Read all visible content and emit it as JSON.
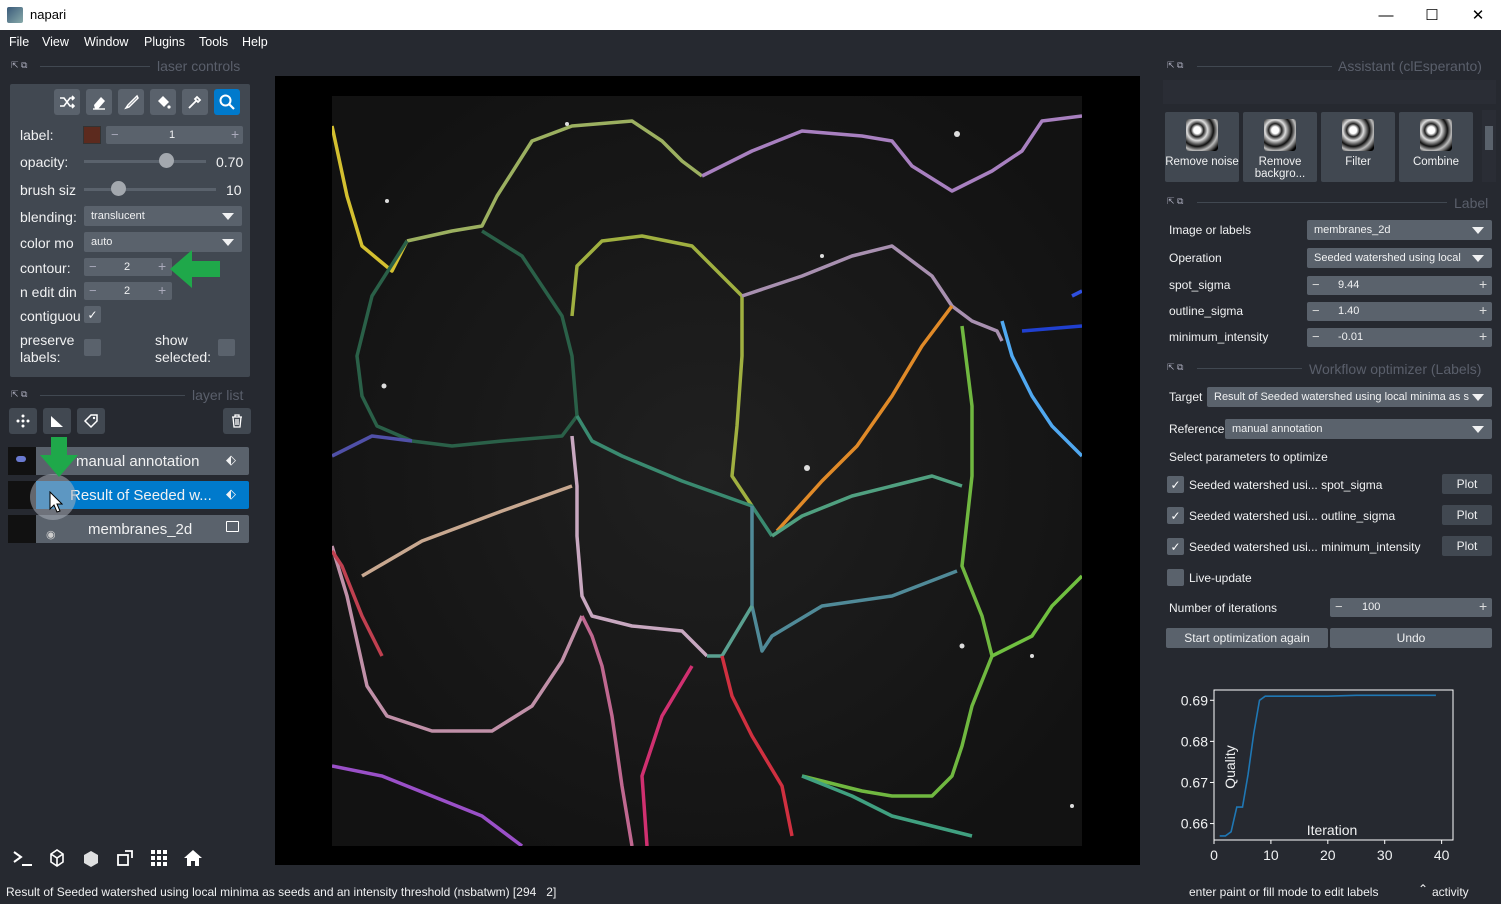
{
  "window": {
    "title": "napari",
    "minimize": "—",
    "maximize": "☐",
    "close": "✕"
  },
  "menu": [
    "File",
    "View",
    "Window",
    "Plugins",
    "Tools",
    "Help"
  ],
  "layer_controls": {
    "header": "laser controls",
    "label_label": "label:",
    "label_value": "1",
    "label_color": "#5c2a1e",
    "opacity_label": "opacity:",
    "opacity_value": "0.70",
    "opacity_fraction": 0.7,
    "brush_label": "brush siz",
    "brush_value": "10",
    "brush_fraction": 0.27,
    "blending_label": "blending:",
    "blending_value": "translucent",
    "colormode_label": "color mo",
    "colormode_value": "auto",
    "contour_label": "contour:",
    "contour_value": "2",
    "ndim_label": "n edit din",
    "ndim_value": "2",
    "contiguous_label": "contiguou",
    "preserve_label": "preserve labels:",
    "show_selected_label": "show selected:"
  },
  "layer_list": {
    "header": "layer list",
    "layers": [
      {
        "name": "manual annotation",
        "selected": false
      },
      {
        "name": "Result of Seeded w...",
        "selected": true
      },
      {
        "name": "membranes_2d",
        "selected": false
      }
    ]
  },
  "assistant": {
    "header": "Assistant (clEsperanto)",
    "tiles": [
      "Remove noise",
      "Remove backgro...",
      "Filter",
      "Combine"
    ]
  },
  "label_widget": {
    "header": "Label",
    "rows": [
      {
        "label": "Image or labels",
        "value": "membranes_2d",
        "type": "combo"
      },
      {
        "label": "Operation",
        "value": "Seeded watershed using local",
        "type": "combo"
      },
      {
        "label": "spot_sigma",
        "value": "9.44",
        "type": "spin"
      },
      {
        "label": "outline_sigma",
        "value": "1.40",
        "type": "spin"
      },
      {
        "label": "minimum_intensity",
        "value": "-0.01",
        "type": "spin"
      }
    ]
  },
  "optimizer": {
    "header": "Workflow optimizer (Labels)",
    "target_label": "Target",
    "target_value": "Result of Seeded watershed using local minima as s",
    "reference_label": "Reference",
    "reference_value": "manual annotation",
    "select_params": "Select parameters to optimize",
    "params": [
      {
        "label": "Seeded watershed usi... spot_sigma",
        "checked": true,
        "button": "Plot"
      },
      {
        "label": "Seeded watershed usi... outline_sigma",
        "checked": true,
        "button": "Plot"
      },
      {
        "label": "Seeded watershed usi... minimum_intensity",
        "checked": true,
        "button": "Plot"
      }
    ],
    "live_update": "Live-update",
    "iterations_label": "Number of iterations",
    "iterations_value": "100",
    "start_button": "Start optimization again",
    "undo_button": "Undo"
  },
  "chart_data": {
    "type": "line",
    "xlabel": "Iteration",
    "ylabel": "Quality",
    "xlim": [
      0,
      42
    ],
    "ylim": [
      0.656,
      0.6925
    ],
    "xticks": [
      0,
      10,
      20,
      30,
      40
    ],
    "yticks": [
      0.66,
      0.67,
      0.68,
      0.69
    ],
    "ytick_labels": [
      "0.66",
      "0.67",
      "0.68",
      "0.69"
    ],
    "series": [
      {
        "color": "#1f77b4",
        "x": [
          1,
          2,
          3,
          4,
          5,
          6,
          7,
          8,
          9,
          10,
          15,
          20,
          25,
          30,
          35,
          39
        ],
        "y": [
          0.657,
          0.657,
          0.658,
          0.664,
          0.664,
          0.672,
          0.682,
          0.69,
          0.691,
          0.691,
          0.691,
          0.691,
          0.6912,
          0.6912,
          0.6912,
          0.6912
        ]
      }
    ]
  },
  "status": {
    "left": "Result of Seeded watershed using local minima as seeds and an intensity threshold (nsbatwm) [294   2]",
    "right": "enter paint or fill mode to edit labels",
    "activity": "activity"
  },
  "colors": {
    "bg": "#262930",
    "panel": "#414851",
    "control": "#5a626c",
    "accent": "#007acc",
    "arrow": "#1fa84a"
  }
}
